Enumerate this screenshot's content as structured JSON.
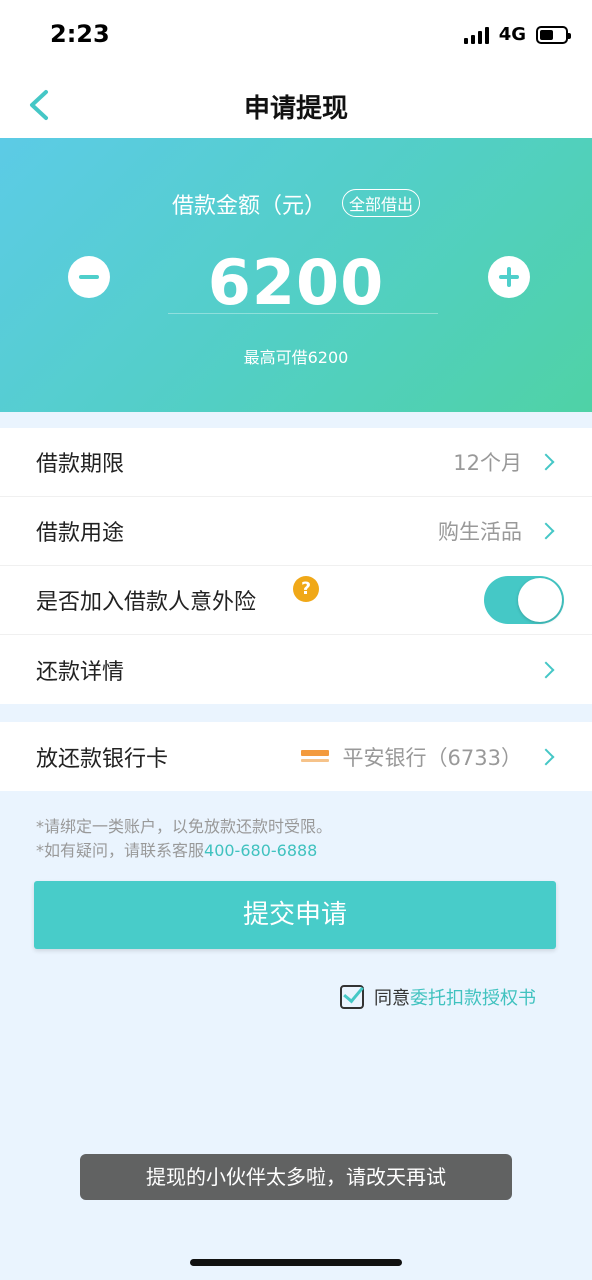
{
  "status_bar": {
    "time": "2:23",
    "network": "4G"
  },
  "nav": {
    "title": "申请提现",
    "back_icon": "chevron-left-icon"
  },
  "hero": {
    "amount_label": "借款金额（元）",
    "all_button": "全部借出",
    "amount": "6200",
    "max_text": "最高可借6200",
    "gradient_colors": [
      "#5ccbe6",
      "#52cfc4",
      "#4fd2a6"
    ]
  },
  "loan_options": {
    "term": {
      "label": "借款期限",
      "value": "12个月"
    },
    "purpose": {
      "label": "借款用途",
      "value": "购生活品"
    },
    "insurance": {
      "label": "是否加入借款人意外险",
      "help_icon": "question-icon",
      "enabled": true
    },
    "repayment": {
      "label": "还款详情"
    }
  },
  "bank": {
    "label": "放还款银行卡",
    "value": "平安银行（6733）"
  },
  "notes": {
    "line1": "*请绑定一类账户，以免放款还款时受限。",
    "line2_prefix": "*如有疑问，请联系客服",
    "phone": "400-680-6888"
  },
  "submit": {
    "label": "提交申请"
  },
  "agreement": {
    "prefix": "同意",
    "link": "委托扣款授权书",
    "checked": true
  },
  "toast": {
    "message": "提现的小伙伴太多啦，请改天再试"
  },
  "colors": {
    "accent": "#45c8c6",
    "background": "#eaf4fe"
  }
}
